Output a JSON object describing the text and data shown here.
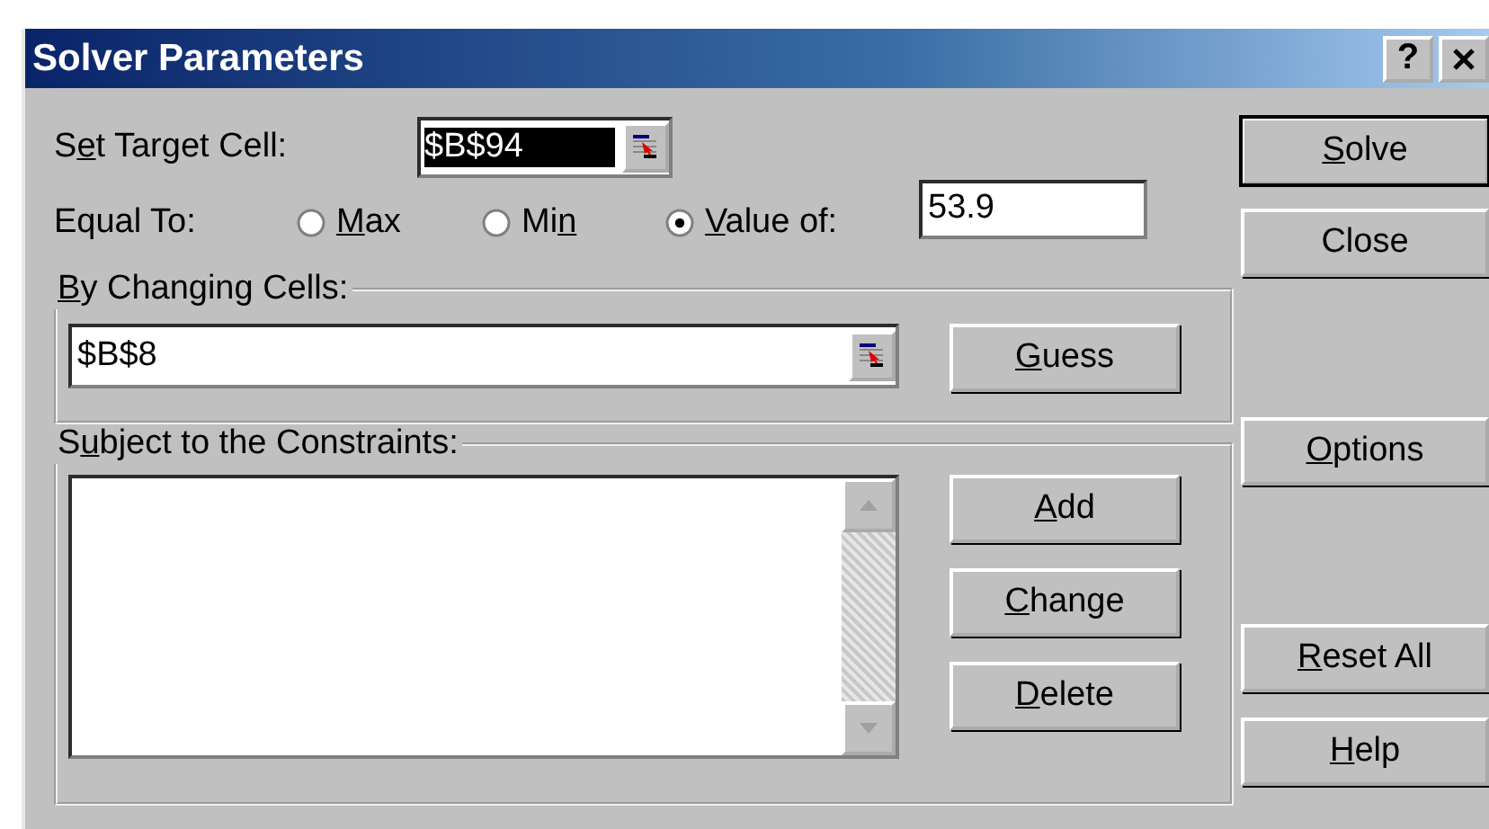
{
  "window": {
    "title": "Solver Parameters",
    "help_button": "?"
  },
  "target": {
    "label": [
      {
        "text": "S",
        "underlined": false
      },
      {
        "text": "e",
        "underlined": true
      },
      {
        "text": "t Target Cell:",
        "underlined": false
      }
    ],
    "value": "$B$94",
    "selected": true
  },
  "equal_to": {
    "label": [
      {
        "text": "Equal To:",
        "underlined": false
      }
    ],
    "options": [
      {
        "label": [
          {
            "text": "M",
            "underlined": true
          },
          {
            "text": "ax",
            "underlined": false
          }
        ],
        "selected": false
      },
      {
        "label": [
          {
            "text": "Mi",
            "underlined": false
          },
          {
            "text": "n",
            "underlined": true
          }
        ],
        "selected": false
      },
      {
        "label": [
          {
            "text": "V",
            "underlined": true
          },
          {
            "text": "alue of:",
            "underlined": false
          }
        ],
        "selected": true
      }
    ],
    "value": "53.9"
  },
  "changing_cells": {
    "label": [
      {
        "text": "B",
        "underlined": true
      },
      {
        "text": "y Changing Cells:",
        "underlined": false
      }
    ],
    "value": "$B$8",
    "button": {
      "label": [
        {
          "text": "G",
          "underlined": true
        },
        {
          "text": "uess",
          "underlined": false
        }
      ]
    }
  },
  "constraints": {
    "label": [
      {
        "text": "S",
        "underlined": false
      },
      {
        "text": "u",
        "underlined": true
      },
      {
        "text": "bject to the Constraints:",
        "underlined": false
      }
    ],
    "buttons": [
      {
        "label": [
          {
            "text": "A",
            "underlined": true
          },
          {
            "text": "dd",
            "underlined": false
          }
        ]
      },
      {
        "label": [
          {
            "text": "C",
            "underlined": true
          },
          {
            "text": "hange",
            "underlined": false
          }
        ]
      },
      {
        "label": [
          {
            "text": "D",
            "underlined": true
          },
          {
            "text": "elete",
            "underlined": false
          }
        ]
      }
    ]
  },
  "side_buttons": [
    {
      "label": [
        {
          "text": "S",
          "underlined": true
        },
        {
          "text": "olve",
          "underlined": false
        }
      ],
      "default": true
    },
    {
      "label": [
        {
          "text": "Close",
          "underlined": false
        }
      ],
      "default": false
    },
    {
      "label": [
        {
          "text": "O",
          "underlined": true
        },
        {
          "text": "ptions",
          "underlined": false
        }
      ],
      "default": false
    },
    {
      "label": [
        {
          "text": "R",
          "underlined": true
        },
        {
          "text": "eset All",
          "underlined": false
        }
      ],
      "default": false
    },
    {
      "label": [
        {
          "text": "H",
          "underlined": true
        },
        {
          "text": "elp",
          "underlined": false
        }
      ],
      "default": false
    }
  ]
}
